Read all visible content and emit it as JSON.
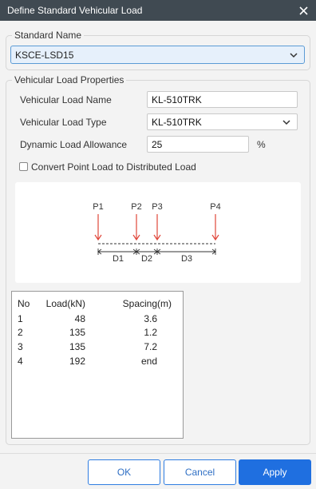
{
  "window": {
    "title": "Define Standard Vehicular Load"
  },
  "standard": {
    "legend": "Standard Name",
    "selected": "KSCE-LSD15"
  },
  "properties": {
    "legend": "Vehicular Load Properties",
    "name_label": "Vehicular Load Name",
    "name_value": "KL-510TRK",
    "type_label": "Vehicular Load Type",
    "type_value": "KL-510TRK",
    "dla_label": "Dynamic Load Allowance",
    "dla_value": "25",
    "dla_unit": "%",
    "convert_label": "Convert Point Load to Distributed Load",
    "convert_checked": false
  },
  "diagram": {
    "loads": [
      "P1",
      "P2",
      "P3",
      "P4"
    ],
    "spacings": [
      "D1",
      "D2",
      "D3"
    ],
    "arrow_color": "#e0463a"
  },
  "table": {
    "headers": {
      "no": "No",
      "load": "Load(kN)",
      "spacing": "Spacing(m)"
    },
    "rows": [
      {
        "no": "1",
        "load": "48",
        "spacing": "3.6"
      },
      {
        "no": "2",
        "load": "135",
        "spacing": "1.2"
      },
      {
        "no": "3",
        "load": "135",
        "spacing": "7.2"
      },
      {
        "no": "4",
        "load": "192",
        "spacing": "end"
      }
    ]
  },
  "buttons": {
    "ok": "OK",
    "cancel": "Cancel",
    "apply": "Apply"
  }
}
